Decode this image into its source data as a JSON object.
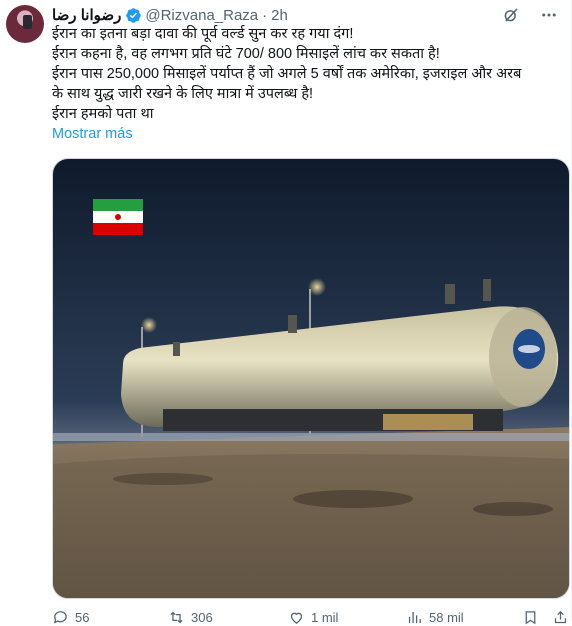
{
  "tweet": {
    "author_name": "رضوانا رضا",
    "handle": "@Rizvana_Raza",
    "separator": "·",
    "time": "2h",
    "lines": [
      "ईरान का इतना बड़ा दावा की पूर्व वर्ल्ड सुन कर रह गया दंग!",
      "ईरान कहना है, वह लगभग प्रति घंटे 700/ 800 मिसाइलें लांच कर सकता है!",
      "ईरान  पास 250,000 मिसाइलें पर्याप्त हैं जो अगले 5 वर्षों तक अमेरिका, इजराइल और अरब",
      "के साथ युद्ध जारी रखने के लिए मात्रा में उपलब्ध है!",
      "ईरान हमको पता था"
    ],
    "show_more": "Mostrar más"
  },
  "actions": {
    "replies": "56",
    "reposts": "306",
    "likes": "1 mil",
    "views": "58 mil"
  },
  "icons": [
    "verified-badge-icon",
    "grok-icon",
    "more-icon",
    "reply-icon",
    "repost-icon",
    "like-icon",
    "views-icon",
    "bookmark-icon",
    "share-icon"
  ],
  "colors": {
    "accent": "#1d9bf0",
    "secondary_text": "#536471",
    "border": "#cfd9de"
  }
}
